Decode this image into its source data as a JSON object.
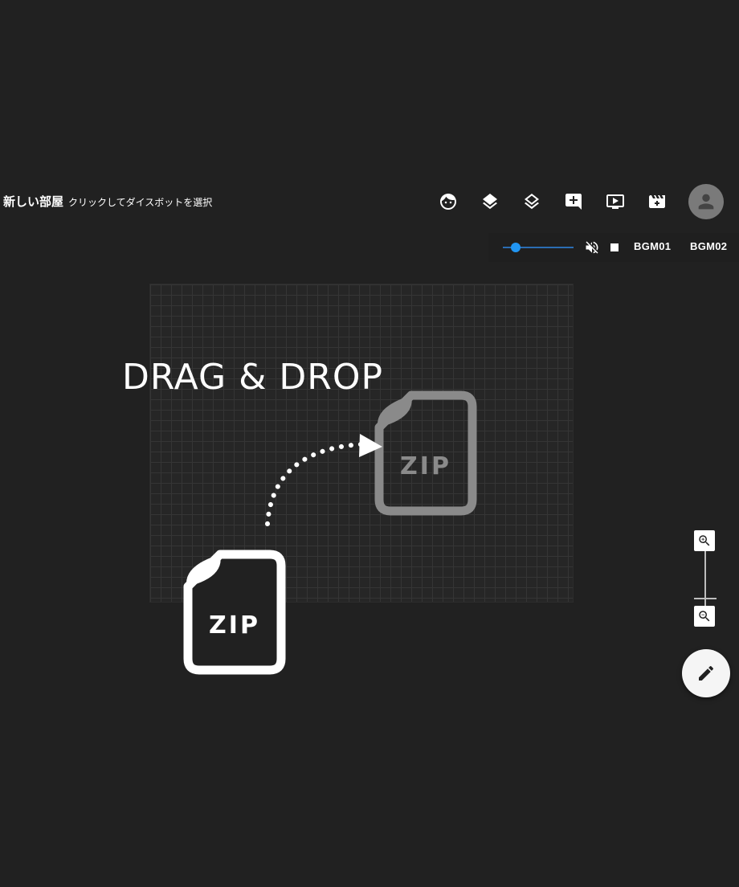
{
  "header": {
    "room_title": "新しい部屋",
    "room_subtitle": "クリックしてダイスボットを選択"
  },
  "toolbar": {
    "icons": [
      "face-icon",
      "layers-icon",
      "layers-outline-icon",
      "add-comment-icon",
      "screen-play-icon",
      "movie-add-icon",
      "account-icon"
    ]
  },
  "bgm": {
    "volume_fraction": 0.18,
    "tracks": [
      "BGM01",
      "BGM02"
    ]
  },
  "board": {
    "instruction": "DRAG & DROP",
    "file_label_source": "ZIP",
    "file_label_target": "ZIP"
  },
  "zoom": {
    "zoom_in": "zoom-in-icon",
    "zoom_out": "zoom-out-icon"
  },
  "fab": {
    "icon": "pencil-icon"
  },
  "colors": {
    "background": "#212121",
    "accent": "#2196f3",
    "grid": "#353535"
  }
}
